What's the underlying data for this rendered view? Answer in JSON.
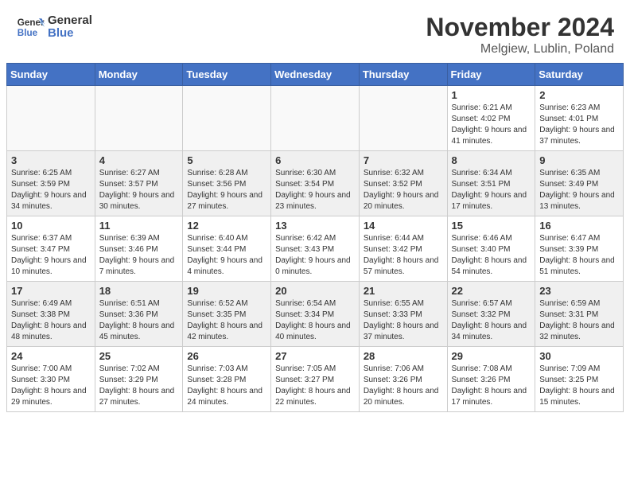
{
  "header": {
    "logo_line1": "General",
    "logo_line2": "Blue",
    "month_year": "November 2024",
    "location": "Melgiew, Lublin, Poland"
  },
  "weekdays": [
    "Sunday",
    "Monday",
    "Tuesday",
    "Wednesday",
    "Thursday",
    "Friday",
    "Saturday"
  ],
  "weeks": [
    [
      {
        "day": "",
        "info": ""
      },
      {
        "day": "",
        "info": ""
      },
      {
        "day": "",
        "info": ""
      },
      {
        "day": "",
        "info": ""
      },
      {
        "day": "",
        "info": ""
      },
      {
        "day": "1",
        "info": "Sunrise: 6:21 AM\nSunset: 4:02 PM\nDaylight: 9 hours and 41 minutes."
      },
      {
        "day": "2",
        "info": "Sunrise: 6:23 AM\nSunset: 4:01 PM\nDaylight: 9 hours and 37 minutes."
      }
    ],
    [
      {
        "day": "3",
        "info": "Sunrise: 6:25 AM\nSunset: 3:59 PM\nDaylight: 9 hours and 34 minutes."
      },
      {
        "day": "4",
        "info": "Sunrise: 6:27 AM\nSunset: 3:57 PM\nDaylight: 9 hours and 30 minutes."
      },
      {
        "day": "5",
        "info": "Sunrise: 6:28 AM\nSunset: 3:56 PM\nDaylight: 9 hours and 27 minutes."
      },
      {
        "day": "6",
        "info": "Sunrise: 6:30 AM\nSunset: 3:54 PM\nDaylight: 9 hours and 23 minutes."
      },
      {
        "day": "7",
        "info": "Sunrise: 6:32 AM\nSunset: 3:52 PM\nDaylight: 9 hours and 20 minutes."
      },
      {
        "day": "8",
        "info": "Sunrise: 6:34 AM\nSunset: 3:51 PM\nDaylight: 9 hours and 17 minutes."
      },
      {
        "day": "9",
        "info": "Sunrise: 6:35 AM\nSunset: 3:49 PM\nDaylight: 9 hours and 13 minutes."
      }
    ],
    [
      {
        "day": "10",
        "info": "Sunrise: 6:37 AM\nSunset: 3:47 PM\nDaylight: 9 hours and 10 minutes."
      },
      {
        "day": "11",
        "info": "Sunrise: 6:39 AM\nSunset: 3:46 PM\nDaylight: 9 hours and 7 minutes."
      },
      {
        "day": "12",
        "info": "Sunrise: 6:40 AM\nSunset: 3:44 PM\nDaylight: 9 hours and 4 minutes."
      },
      {
        "day": "13",
        "info": "Sunrise: 6:42 AM\nSunset: 3:43 PM\nDaylight: 9 hours and 0 minutes."
      },
      {
        "day": "14",
        "info": "Sunrise: 6:44 AM\nSunset: 3:42 PM\nDaylight: 8 hours and 57 minutes."
      },
      {
        "day": "15",
        "info": "Sunrise: 6:46 AM\nSunset: 3:40 PM\nDaylight: 8 hours and 54 minutes."
      },
      {
        "day": "16",
        "info": "Sunrise: 6:47 AM\nSunset: 3:39 PM\nDaylight: 8 hours and 51 minutes."
      }
    ],
    [
      {
        "day": "17",
        "info": "Sunrise: 6:49 AM\nSunset: 3:38 PM\nDaylight: 8 hours and 48 minutes."
      },
      {
        "day": "18",
        "info": "Sunrise: 6:51 AM\nSunset: 3:36 PM\nDaylight: 8 hours and 45 minutes."
      },
      {
        "day": "19",
        "info": "Sunrise: 6:52 AM\nSunset: 3:35 PM\nDaylight: 8 hours and 42 minutes."
      },
      {
        "day": "20",
        "info": "Sunrise: 6:54 AM\nSunset: 3:34 PM\nDaylight: 8 hours and 40 minutes."
      },
      {
        "day": "21",
        "info": "Sunrise: 6:55 AM\nSunset: 3:33 PM\nDaylight: 8 hours and 37 minutes."
      },
      {
        "day": "22",
        "info": "Sunrise: 6:57 AM\nSunset: 3:32 PM\nDaylight: 8 hours and 34 minutes."
      },
      {
        "day": "23",
        "info": "Sunrise: 6:59 AM\nSunset: 3:31 PM\nDaylight: 8 hours and 32 minutes."
      }
    ],
    [
      {
        "day": "24",
        "info": "Sunrise: 7:00 AM\nSunset: 3:30 PM\nDaylight: 8 hours and 29 minutes."
      },
      {
        "day": "25",
        "info": "Sunrise: 7:02 AM\nSunset: 3:29 PM\nDaylight: 8 hours and 27 minutes."
      },
      {
        "day": "26",
        "info": "Sunrise: 7:03 AM\nSunset: 3:28 PM\nDaylight: 8 hours and 24 minutes."
      },
      {
        "day": "27",
        "info": "Sunrise: 7:05 AM\nSunset: 3:27 PM\nDaylight: 8 hours and 22 minutes."
      },
      {
        "day": "28",
        "info": "Sunrise: 7:06 AM\nSunset: 3:26 PM\nDaylight: 8 hours and 20 minutes."
      },
      {
        "day": "29",
        "info": "Sunrise: 7:08 AM\nSunset: 3:26 PM\nDaylight: 8 hours and 17 minutes."
      },
      {
        "day": "30",
        "info": "Sunrise: 7:09 AM\nSunset: 3:25 PM\nDaylight: 8 hours and 15 minutes."
      }
    ]
  ]
}
